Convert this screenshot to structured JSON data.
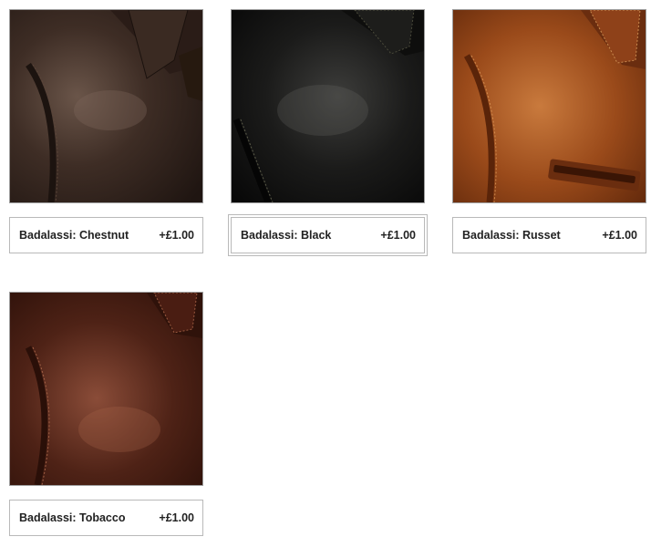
{
  "options": [
    {
      "name": "Badalassi: Chestnut",
      "price": "+£1.00",
      "color": "#3b2a22",
      "selected": false
    },
    {
      "name": "Badalassi: Black",
      "price": "+£1.00",
      "color": "#141414",
      "selected": true
    },
    {
      "name": "Badalassi: Russet",
      "price": "+£1.00",
      "color": "#9a4a1a",
      "selected": false
    },
    {
      "name": "Badalassi: Tobacco",
      "price": "+£1.00",
      "color": "#4e2216",
      "selected": false
    }
  ]
}
